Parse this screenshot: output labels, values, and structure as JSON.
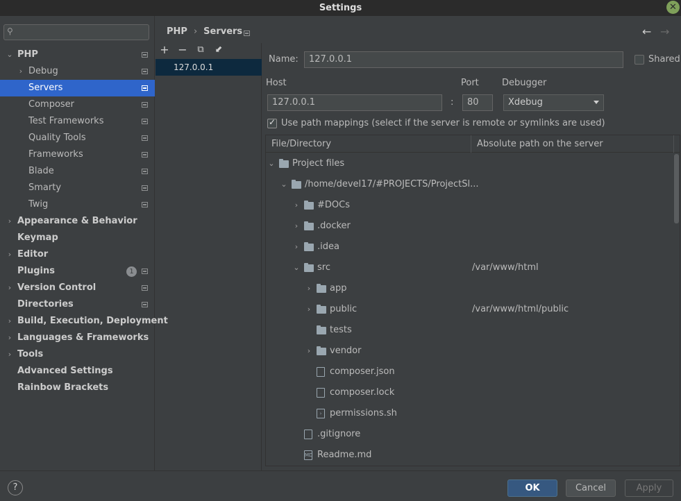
{
  "window": {
    "title": "Settings"
  },
  "search": {
    "placeholder": ""
  },
  "sidebar": {
    "items": [
      {
        "label": "PHP",
        "bold": true,
        "arrow": "⌄",
        "indent": 0,
        "mod": true
      },
      {
        "label": "Debug",
        "arrow": "›",
        "indent": 1,
        "mod": true
      },
      {
        "label": "Servers",
        "indent": 1,
        "mod": true,
        "selected": true
      },
      {
        "label": "Composer",
        "indent": 1,
        "mod": true
      },
      {
        "label": "Test Frameworks",
        "indent": 1,
        "mod": true
      },
      {
        "label": "Quality Tools",
        "indent": 1,
        "mod": true
      },
      {
        "label": "Frameworks",
        "indent": 1,
        "mod": true
      },
      {
        "label": "Blade",
        "indent": 1,
        "mod": true
      },
      {
        "label": "Smarty",
        "indent": 1,
        "mod": true
      },
      {
        "label": "Twig",
        "indent": 1,
        "mod": true
      },
      {
        "label": "Appearance & Behavior",
        "bold": true,
        "arrow": "›",
        "indent": 0
      },
      {
        "label": "Keymap",
        "bold": true,
        "indent": 0
      },
      {
        "label": "Editor",
        "bold": true,
        "arrow": "›",
        "indent": 0
      },
      {
        "label": "Plugins",
        "bold": true,
        "indent": 0,
        "badge": "1",
        "mod": true
      },
      {
        "label": "Version Control",
        "bold": true,
        "arrow": "›",
        "indent": 0,
        "mod": true
      },
      {
        "label": "Directories",
        "bold": true,
        "indent": 0,
        "mod": true
      },
      {
        "label": "Build, Execution, Deployment",
        "bold": true,
        "arrow": "›",
        "indent": 0
      },
      {
        "label": "Languages & Frameworks",
        "bold": true,
        "arrow": "›",
        "indent": 0
      },
      {
        "label": "Tools",
        "bold": true,
        "arrow": "›",
        "indent": 0
      },
      {
        "label": "Advanced Settings",
        "bold": true,
        "indent": 0
      },
      {
        "label": "Rainbow Brackets",
        "bold": true,
        "indent": 0
      }
    ]
  },
  "breadcrumb": {
    "part1": "PHP",
    "sep": "›",
    "part2": "Servers"
  },
  "nav": {
    "back": "←",
    "forward": "→"
  },
  "toolbar": {
    "add": "+",
    "remove": "−",
    "copy": "⧉",
    "import": "⬋"
  },
  "servers": {
    "items": [
      "127.0.0.1"
    ]
  },
  "form": {
    "name_label": "Name:",
    "name_value": "127.0.0.1",
    "shared_label": "Shared",
    "host_label": "Host",
    "host_value": "127.0.0.1",
    "port_label": "Port",
    "port_sep": ":",
    "port_value": "80",
    "debugger_label": "Debugger",
    "debugger_value": "Xdebug",
    "use_mappings_label": "Use path mappings (select if the server is remote or symlinks are used)"
  },
  "mappings": {
    "columns": [
      "File/Directory",
      "Absolute path on the server"
    ],
    "rows": [
      {
        "name": "Project files",
        "arrow": "⌄",
        "depth": 0,
        "icon": "folder",
        "path": ""
      },
      {
        "name": "/home/devel17/#PROJECTS/ProjectSl...",
        "arrow": "⌄",
        "depth": 1,
        "icon": "folder",
        "path": ""
      },
      {
        "name": "#DOCs",
        "arrow": "›",
        "depth": 2,
        "icon": "folder",
        "path": ""
      },
      {
        "name": ".docker",
        "arrow": "›",
        "depth": 2,
        "icon": "folder",
        "path": ""
      },
      {
        "name": ".idea",
        "arrow": "›",
        "depth": 2,
        "icon": "folder",
        "path": ""
      },
      {
        "name": "src",
        "arrow": "⌄",
        "depth": 2,
        "icon": "folder",
        "path": "/var/www/html"
      },
      {
        "name": "app",
        "arrow": "›",
        "depth": 3,
        "icon": "folder",
        "path": ""
      },
      {
        "name": "public",
        "arrow": "›",
        "depth": 3,
        "icon": "folder",
        "path": "/var/www/html/public"
      },
      {
        "name": "tests",
        "arrow": "",
        "depth": 3,
        "icon": "folder",
        "path": ""
      },
      {
        "name": "vendor",
        "arrow": "›",
        "depth": 3,
        "icon": "folder",
        "path": ""
      },
      {
        "name": "composer.json",
        "arrow": "",
        "depth": 3,
        "icon": "file",
        "path": ""
      },
      {
        "name": "composer.lock",
        "arrow": "",
        "depth": 3,
        "icon": "file",
        "path": ""
      },
      {
        "name": "permissions.sh",
        "arrow": "",
        "depth": 3,
        "icon": "shell",
        "path": ""
      },
      {
        "name": ".gitignore",
        "arrow": "",
        "depth": 2,
        "icon": "file",
        "path": ""
      },
      {
        "name": "Readme.md",
        "arrow": "",
        "depth": 2,
        "icon": "md",
        "path": ""
      }
    ]
  },
  "footer": {
    "help": "?",
    "ok": "OK",
    "cancel": "Cancel",
    "apply": "Apply"
  }
}
